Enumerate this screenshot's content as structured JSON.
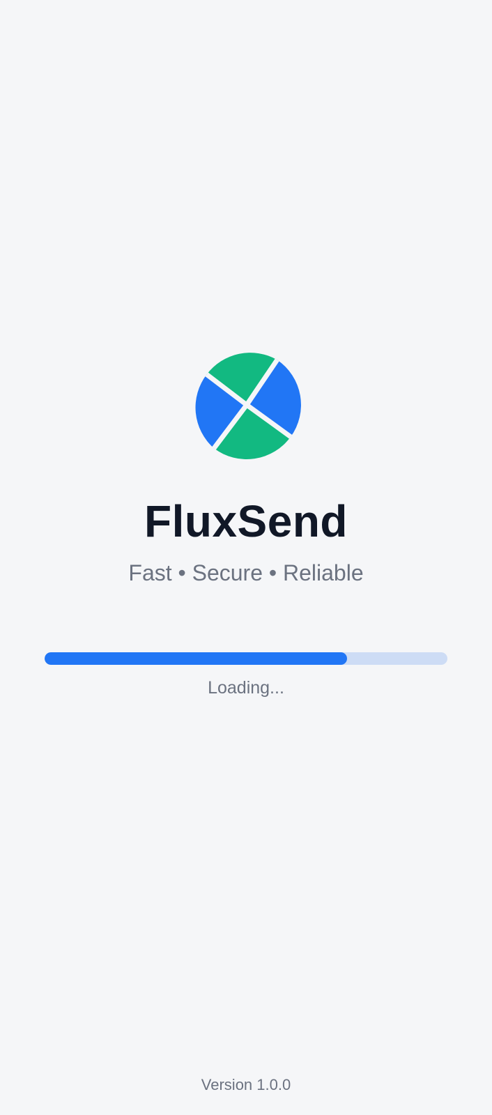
{
  "app": {
    "name": "FluxSend",
    "tagline": "Fast • Secure • Reliable"
  },
  "logo": {
    "icon": "fluxsend-logo-icon",
    "colors": {
      "green": "#12b981",
      "blue": "#2176f5",
      "separator": "#f5f6f8"
    }
  },
  "loading": {
    "status": "Loading...",
    "progress_percent": 75,
    "bar_color": "#2176f5",
    "track_color": "#cddcf5"
  },
  "footer": {
    "version": "Version 1.0.0"
  }
}
